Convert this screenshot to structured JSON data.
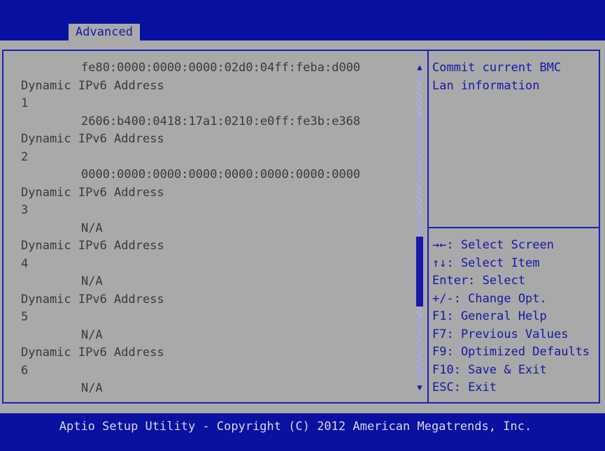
{
  "header": {
    "active_tab": "Advanced"
  },
  "entries": [
    {
      "lines": [],
      "value": "fe80:0000:0000:0000:02d0:04ff:feba:d000"
    },
    {
      "lines": [
        "Dynamic IPv6 Address",
        "1"
      ],
      "value": "2606:b400:0418:17a1:0210:e0ff:fe3b:e368"
    },
    {
      "lines": [
        "Dynamic IPv6 Address",
        "2"
      ],
      "value": "0000:0000:0000:0000:0000:0000:0000:0000"
    },
    {
      "lines": [
        "Dynamic IPv6 Address",
        "3"
      ],
      "value": "N/A"
    },
    {
      "lines": [
        "Dynamic IPv6 Address",
        "4"
      ],
      "value": "N/A"
    },
    {
      "lines": [
        "Dynamic IPv6 Address",
        "5"
      ],
      "value": "N/A"
    },
    {
      "lines": [
        "Dynamic IPv6 Address",
        "6"
      ],
      "value": "N/A"
    }
  ],
  "help": {
    "lines": [
      "Commit current BMC",
      "Lan information"
    ]
  },
  "keys": [
    "→←: Select Screen",
    "↑↓: Select Item",
    "Enter: Select",
    "+/-: Change Opt.",
    "F1: General Help",
    "F7: Previous Values",
    "F9: Optimized Defaults",
    "F10: Save & Exit",
    "ESC: Exit"
  ],
  "scrollbar": {
    "up_icon": "▲",
    "down_icon": "▼"
  },
  "footer": {
    "copyright": "Aptio Setup Utility - Copyright (C) 2012 American Megatrends, Inc."
  },
  "colors": {
    "bios_blue": "#0a10a0",
    "panel_gray": "#a9a9a9",
    "highlight_blue": "#1518a8"
  }
}
